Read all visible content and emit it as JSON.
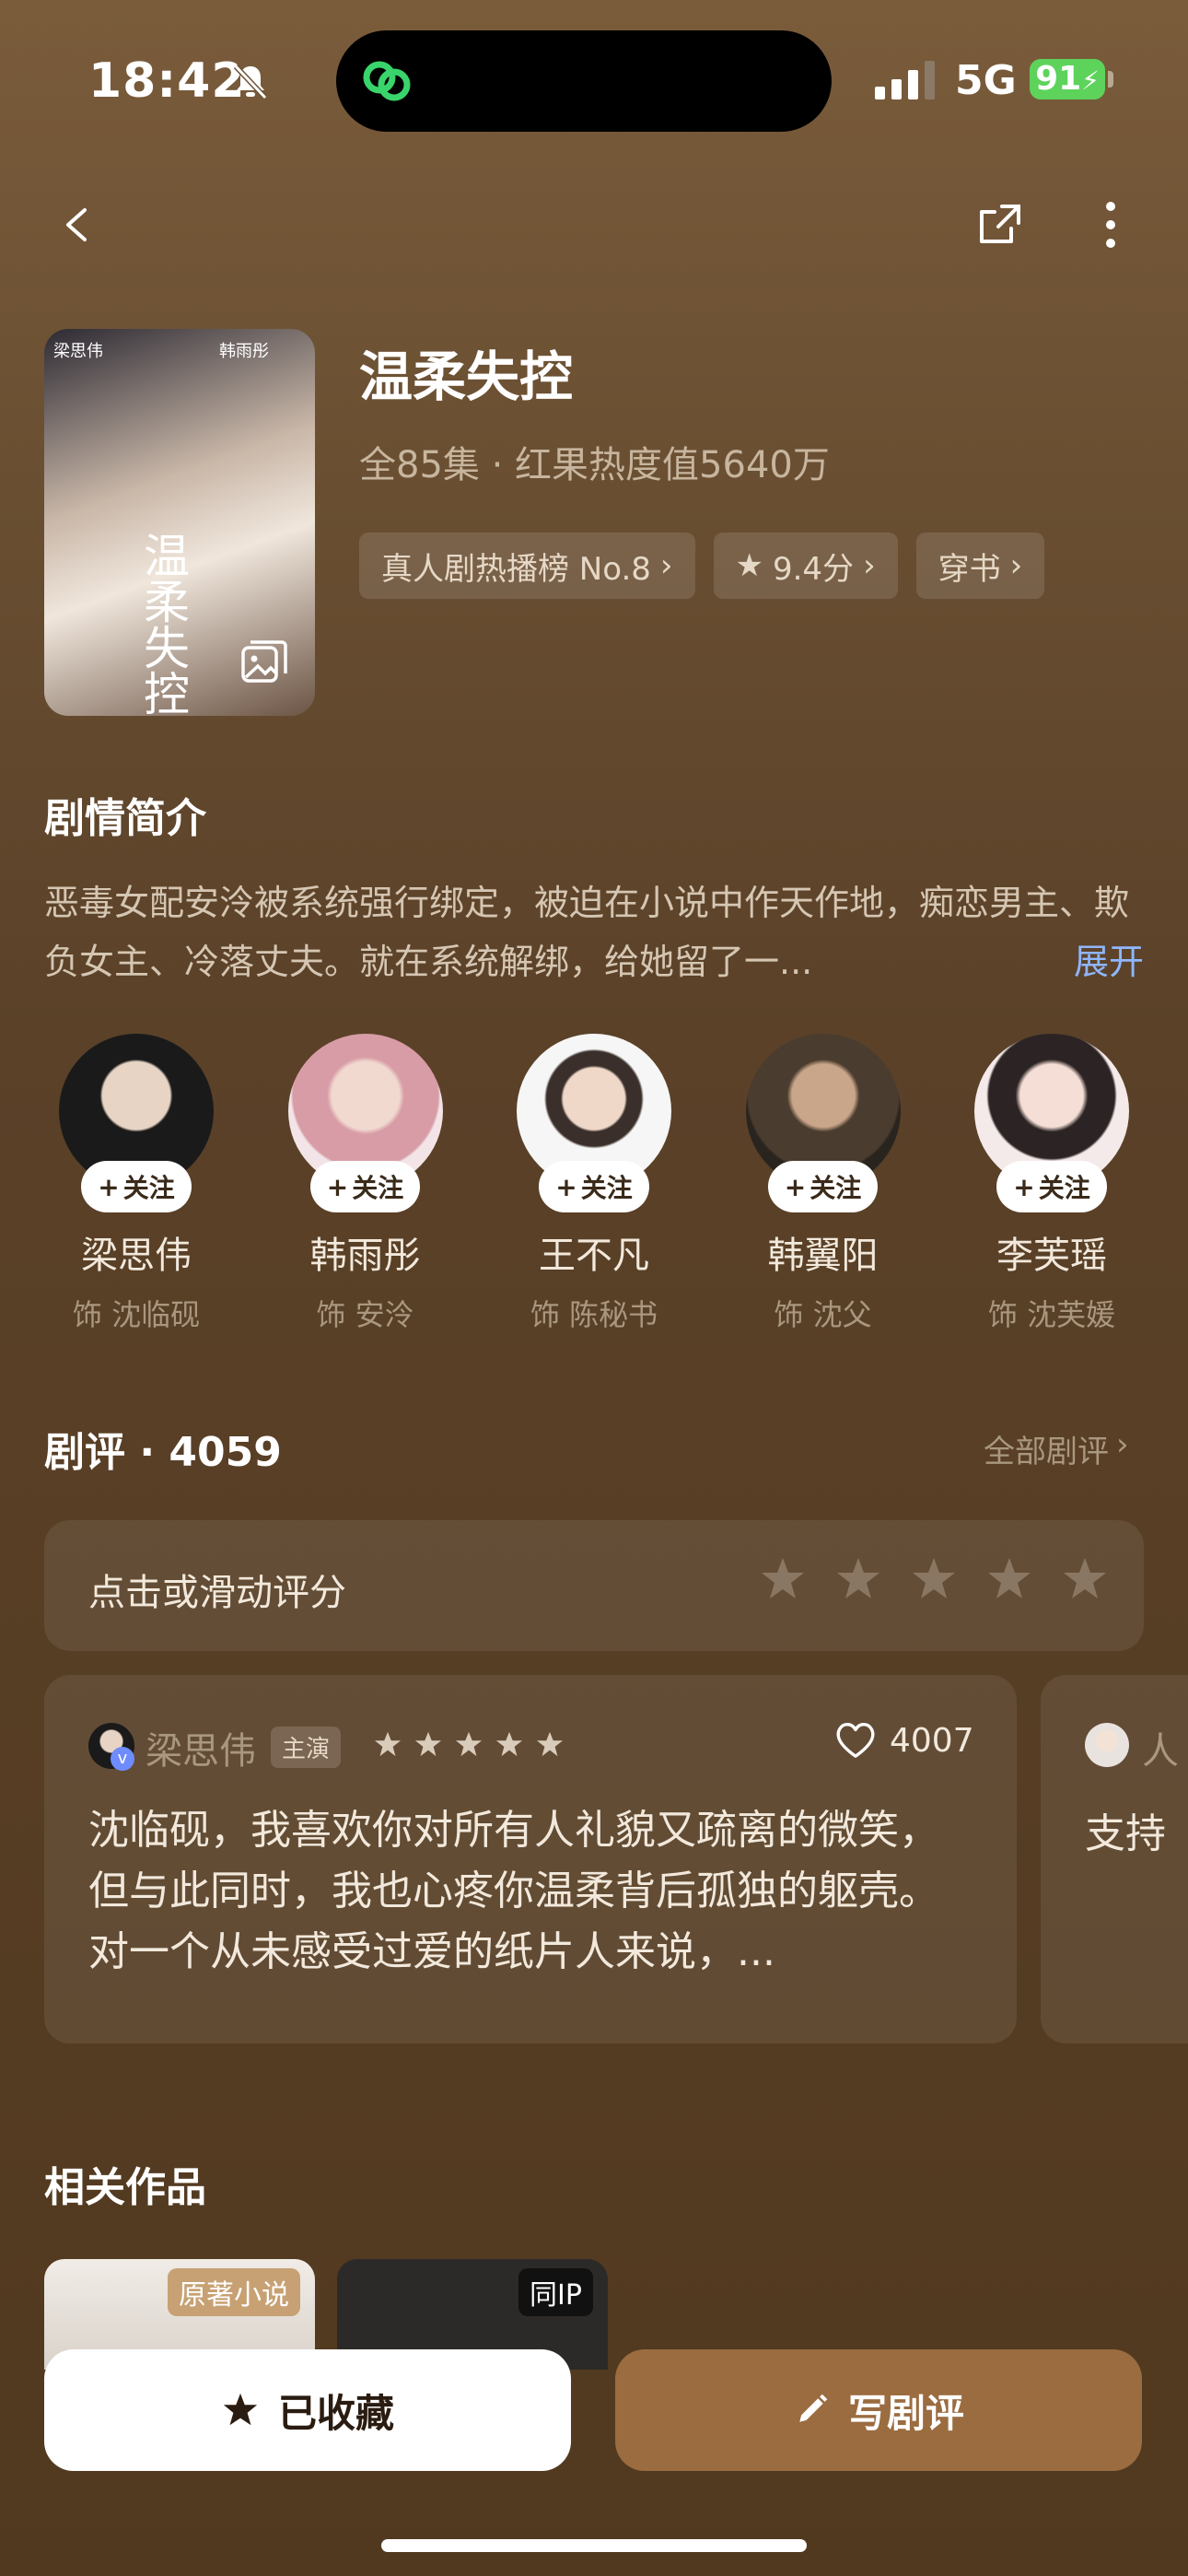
{
  "status_bar": {
    "time": "18:42",
    "network": "5G",
    "battery": "91"
  },
  "drama": {
    "title": "温柔失控",
    "meta": "全85集 · 红果热度值5640万",
    "tags": [
      {
        "label": "真人剧热播榜 No.8"
      },
      {
        "label": "9.4分"
      },
      {
        "label": "穿书"
      }
    ],
    "poster_text": {
      "vertical_title": "温柔失控",
      "actor_left": "梁思伟",
      "actor_right": "韩雨彤"
    }
  },
  "synopsis": {
    "heading": "剧情简介",
    "text": "恶毒女配安泠被系统强行绑定，被迫在小说中作天作地，痴恋男主、欺负女主、冷落丈夫。就在系统解绑，给她留了一...",
    "expand": "展开"
  },
  "cast": [
    {
      "name": "梁思伟",
      "role": "饰 沈临砚",
      "follow": "关注"
    },
    {
      "name": "韩雨彤",
      "role": "饰 安泠",
      "follow": "关注"
    },
    {
      "name": "王不凡",
      "role": "饰 陈秘书",
      "follow": "关注"
    },
    {
      "name": "韩翼阳",
      "role": "饰 沈父",
      "follow": "关注"
    },
    {
      "name": "李芙瑶",
      "role": "饰 沈芙媛",
      "follow": "关注"
    }
  ],
  "reviews": {
    "heading": "剧评 · 4059",
    "all_link": "全部剧评",
    "rate_prompt": "点击或滑动评分",
    "items": [
      {
        "author": "梁思伟",
        "badge": "主演",
        "stars": 5,
        "likes": "4007",
        "text": "沈临砚，我喜欢你对所有人礼貌又疏离的微笑，但与此同时，我也心疼你温柔背后孤独的躯壳。对一个从未感受过爱的纸片人来说，..."
      },
      {
        "author": "人",
        "text": "支持"
      }
    ]
  },
  "related": {
    "heading": "相关作品",
    "items": [
      {
        "badge": "原著小说"
      },
      {
        "badge": "同IP"
      }
    ]
  },
  "actions": {
    "favorite": "已收藏",
    "write_review": "写剧评"
  },
  "colors": {
    "accent": "#9a6c40",
    "link": "#8fb6ff",
    "battery": "#5dd35b"
  }
}
